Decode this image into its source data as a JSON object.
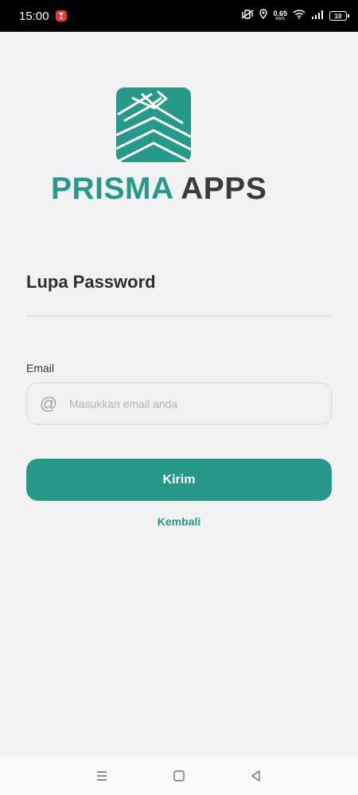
{
  "status_bar": {
    "time": "15:00",
    "network_speed_value": "0.65",
    "network_speed_unit": "KB/S",
    "battery_level": "10",
    "icons": [
      "notification-app-icon",
      "vibrate-icon",
      "location-icon",
      "wifi-icon",
      "signal-icon",
      "battery-icon"
    ]
  },
  "brand": {
    "word_1": "PRISMA",
    "word_2": "APPS",
    "primary_color": "#26998a",
    "secondary_color": "#3b3b3b"
  },
  "page": {
    "title": "Lupa Password"
  },
  "form": {
    "email_label": "Email",
    "email_icon": "@",
    "email_value": "",
    "email_placeholder": "Masukkan email anda",
    "submit_label": "Kirim",
    "back_label": "Kembali"
  },
  "nav_bar": {
    "icons": [
      "menu-icon",
      "home-icon",
      "back-icon"
    ]
  }
}
